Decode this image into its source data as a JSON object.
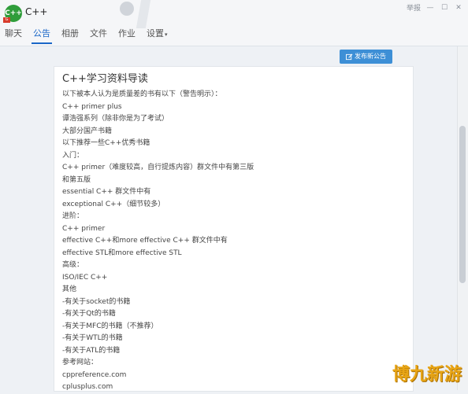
{
  "app": {
    "logo_text": "C++",
    "logo_badge": "G",
    "title": "C++"
  },
  "window_controls": {
    "report_label": "举报",
    "minimize": "—",
    "maximize": "☐",
    "close": "✕"
  },
  "tabs": [
    {
      "label": "聊天",
      "active": false
    },
    {
      "label": "公告",
      "active": true
    },
    {
      "label": "相册",
      "active": false
    },
    {
      "label": "文件",
      "active": false
    },
    {
      "label": "作业",
      "active": false
    },
    {
      "label": "设置",
      "active": false,
      "dropdown": true
    }
  ],
  "toolbar": {
    "publish_label": "发布新公告"
  },
  "announcement": {
    "title": "C++学习资料导读",
    "lines": [
      "以下被本人认为是质量差的书有以下（警告明示）：",
      "C++ primer plus",
      "谭浩强系列（除非你是为了考试）",
      "大部分国产书籍",
      "以下推荐一些C++优秀书籍",
      "入门：",
      "C++ primer（难度较高，自行提炼内容）群文件中有第三版",
      "和第五版",
      "essential C++ 群文件中有",
      "exceptional C++（细节较多）",
      "进阶：",
      "C++ primer",
      "effective C++和more effective C++ 群文件中有",
      "effective STL和more effective STL",
      "高级：",
      "ISO/IEC C++",
      "其他",
      "-有关于socket的书籍",
      "-有关于Qt的书籍",
      "-有关于MFC的书籍（不推荐）",
      "-有关于WTL的书籍",
      "-有关于ATL的书籍",
      "参考网站：",
      "cppreference.com",
      "cplusplus.com"
    ]
  },
  "watermark": "博九新游",
  "colors": {
    "accent": "#1a66c7",
    "button": "#3d8fd6",
    "logo": "#2f9d3a",
    "watermark": "#e8a515"
  }
}
